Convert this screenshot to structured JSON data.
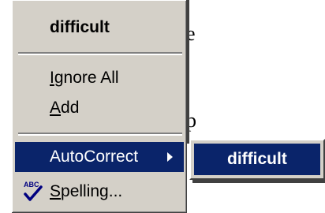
{
  "document": {
    "fragments": [
      "e",
      "p"
    ]
  },
  "menu": {
    "suggestion": "difficult",
    "ignore_all": {
      "mnemonic": "I",
      "rest": "gnore All"
    },
    "add": {
      "mnemonic": "A",
      "rest": "dd"
    },
    "autocorrect": "AutoCorrect",
    "spelling": {
      "mnemonic": "S",
      "rest": "pelling..."
    },
    "spelling_icon_text": "ABC"
  },
  "submenu": {
    "item": "difficult"
  },
  "colors": {
    "menu_bg": "#d4d0c8",
    "highlight": "#0a246a",
    "highlight_text": "#ffffff"
  }
}
